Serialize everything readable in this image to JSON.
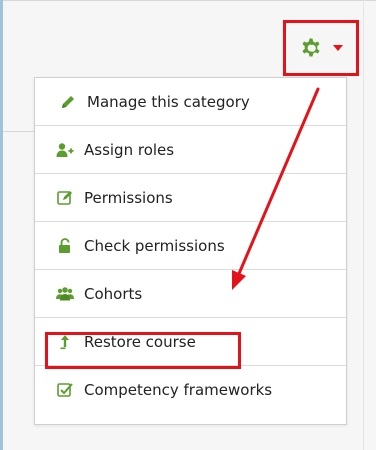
{
  "menu": {
    "items": [
      {
        "label": "Manage this category",
        "icon": "pencil-icon"
      },
      {
        "label": "Assign roles",
        "icon": "user-plus-icon"
      },
      {
        "label": "Permissions",
        "icon": "edit-square-icon"
      },
      {
        "label": "Check permissions",
        "icon": "unlock-icon"
      },
      {
        "label": "Cohorts",
        "icon": "users-icon"
      },
      {
        "label": "Restore course",
        "icon": "upload-arrow-icon"
      },
      {
        "label": "Competency frameworks",
        "icon": "check-square-icon"
      }
    ]
  },
  "colors": {
    "annotation_red": "#e4121b",
    "icon_green": "#5b9d2e",
    "accent_blue": "#9fc3dc"
  }
}
